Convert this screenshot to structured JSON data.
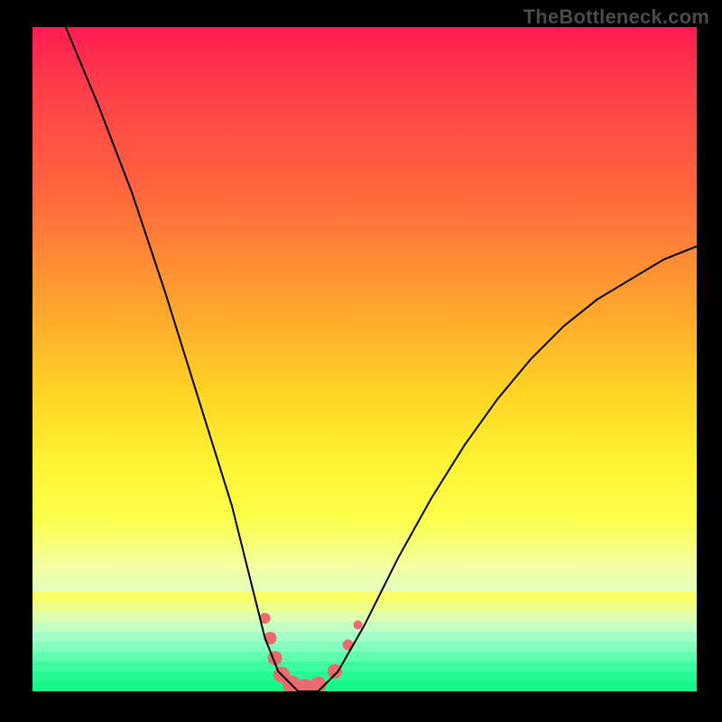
{
  "watermark": "TheBottleneck.com",
  "chart_data": {
    "type": "line",
    "title": "",
    "xlabel": "",
    "ylabel": "",
    "xlim": [
      0,
      100
    ],
    "ylim": [
      0,
      100
    ],
    "grid": false,
    "curve": [
      {
        "x": 5,
        "y": 100
      },
      {
        "x": 10,
        "y": 88
      },
      {
        "x": 15,
        "y": 75
      },
      {
        "x": 20,
        "y": 60
      },
      {
        "x": 25,
        "y": 44
      },
      {
        "x": 30,
        "y": 28
      },
      {
        "x": 33,
        "y": 16
      },
      {
        "x": 35,
        "y": 8
      },
      {
        "x": 37,
        "y": 3
      },
      {
        "x": 40,
        "y": 0
      },
      {
        "x": 43,
        "y": 0
      },
      {
        "x": 46,
        "y": 3
      },
      {
        "x": 50,
        "y": 10
      },
      {
        "x": 55,
        "y": 20
      },
      {
        "x": 60,
        "y": 29
      },
      {
        "x": 65,
        "y": 37
      },
      {
        "x": 70,
        "y": 44
      },
      {
        "x": 75,
        "y": 50
      },
      {
        "x": 80,
        "y": 55
      },
      {
        "x": 85,
        "y": 59
      },
      {
        "x": 90,
        "y": 62
      },
      {
        "x": 95,
        "y": 65
      },
      {
        "x": 100,
        "y": 67
      }
    ],
    "markers": [
      {
        "x": 35.0,
        "y": 11.0,
        "r": 6
      },
      {
        "x": 35.8,
        "y": 8.0,
        "r": 7
      },
      {
        "x": 36.5,
        "y": 5.0,
        "r": 8
      },
      {
        "x": 37.5,
        "y": 2.5,
        "r": 9
      },
      {
        "x": 39.0,
        "y": 1.0,
        "r": 10
      },
      {
        "x": 41.0,
        "y": 0.5,
        "r": 10
      },
      {
        "x": 43.0,
        "y": 1.0,
        "r": 9
      },
      {
        "x": 45.5,
        "y": 3.0,
        "r": 8
      },
      {
        "x": 47.5,
        "y": 7.0,
        "r": 6
      },
      {
        "x": 49.0,
        "y": 10.0,
        "r": 5
      }
    ],
    "marker_color": "#e96a6f",
    "curve_color": "#000000",
    "bottom_bands": [
      "#f9ff64",
      "#edff8a",
      "#ddffb0",
      "#c3ffc2",
      "#a3ffc6",
      "#82ffbe",
      "#5effae",
      "#3dfca0",
      "#24f994",
      "#15f98b"
    ]
  }
}
